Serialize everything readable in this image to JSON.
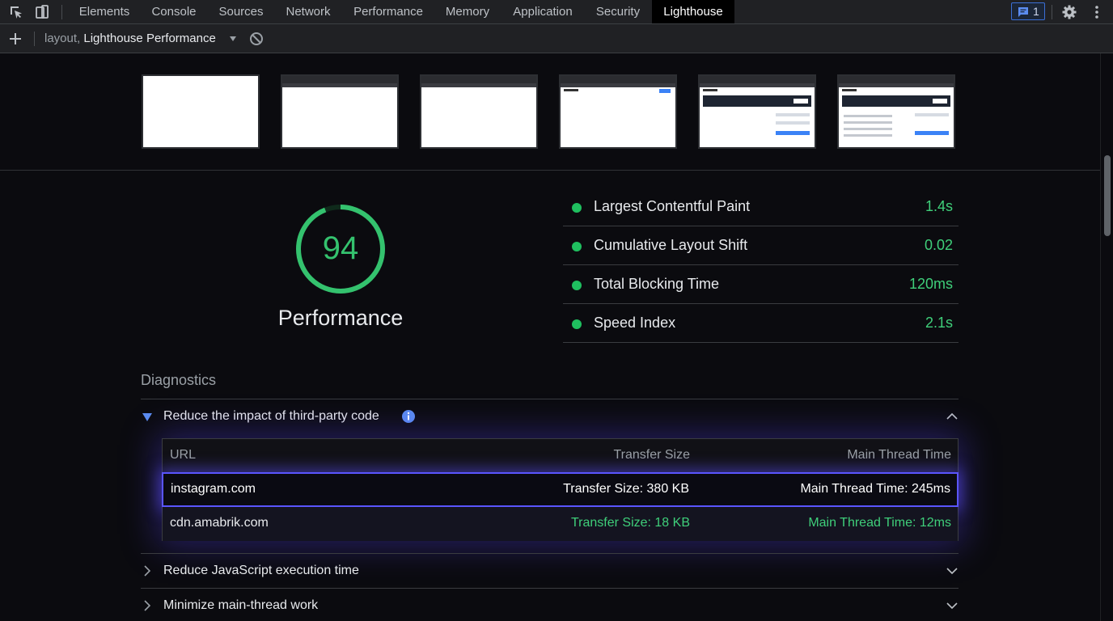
{
  "devtools": {
    "tabs": [
      {
        "label": "Elements"
      },
      {
        "label": "Console"
      },
      {
        "label": "Sources"
      },
      {
        "label": "Network"
      },
      {
        "label": "Performance"
      },
      {
        "label": "Memory"
      },
      {
        "label": "Application"
      },
      {
        "label": "Security"
      },
      {
        "label": "Lighthouse",
        "active": true
      }
    ],
    "message_count": "1"
  },
  "toolbar": {
    "report_prefix": "layout,",
    "report_name": "Lighthouse Performance"
  },
  "summary": {
    "score": "94",
    "category": "Performance",
    "score_color": "#34c26e"
  },
  "metrics": [
    {
      "name": "Largest Contentful Paint",
      "value": "1.4s"
    },
    {
      "name": "Cumulative Layout Shift",
      "value": "0.02"
    },
    {
      "name": "Total Blocking Time",
      "value": "120ms"
    },
    {
      "name": "Speed Index",
      "value": "2.1s"
    }
  ],
  "diagnostics": {
    "title": "Diagnostics",
    "audits": [
      {
        "title": "Reduce the impact of third-party code",
        "expanded": true
      },
      {
        "title": "Reduce JavaScript execution time",
        "expanded": false
      },
      {
        "title": "Minimize main-thread work",
        "expanded": false
      }
    ],
    "table": {
      "headers": [
        "URL",
        "Transfer Size",
        "Main Thread Time"
      ],
      "rows": [
        {
          "url": "instagram.com",
          "transfer": "Transfer Size: 380 KB",
          "time": "Main Thread Time: 245ms"
        },
        {
          "url": "cdn.amabrik.com",
          "transfer": "Transfer Size: 18 KB",
          "time": "Main Thread Time: 12ms"
        }
      ]
    }
  }
}
